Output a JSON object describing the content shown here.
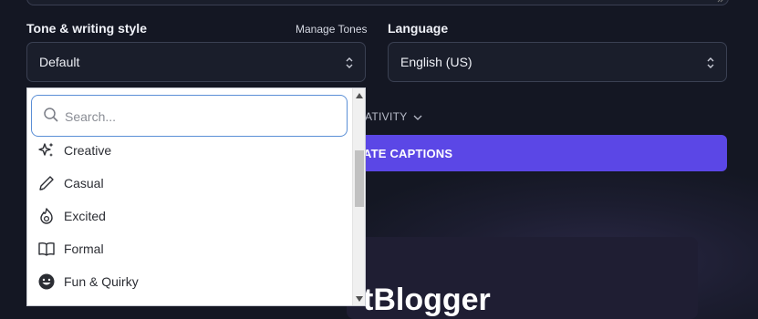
{
  "tone": {
    "label": "Tone & writing style",
    "manage_link": "Manage Tones",
    "selected": "Default",
    "search_placeholder": "Search...",
    "options": [
      {
        "label": "Creative",
        "icon": "sparkles-icon"
      },
      {
        "label": "Casual",
        "icon": "pencil-icon"
      },
      {
        "label": "Excited",
        "icon": "flame-icon"
      },
      {
        "label": "Formal",
        "icon": "book-icon"
      },
      {
        "label": "Fun & Quirky",
        "icon": "smiley-icon"
      }
    ]
  },
  "language": {
    "label": "Language",
    "selected": "English (US)"
  },
  "creativity": {
    "label": "ATIVITY"
  },
  "generate": {
    "label": "ATE CAPTIONS"
  },
  "preview": {
    "text": "tBlogger"
  },
  "colors": {
    "accent": "#5b47e6",
    "background": "#141723",
    "focus": "#5b8fd6"
  }
}
